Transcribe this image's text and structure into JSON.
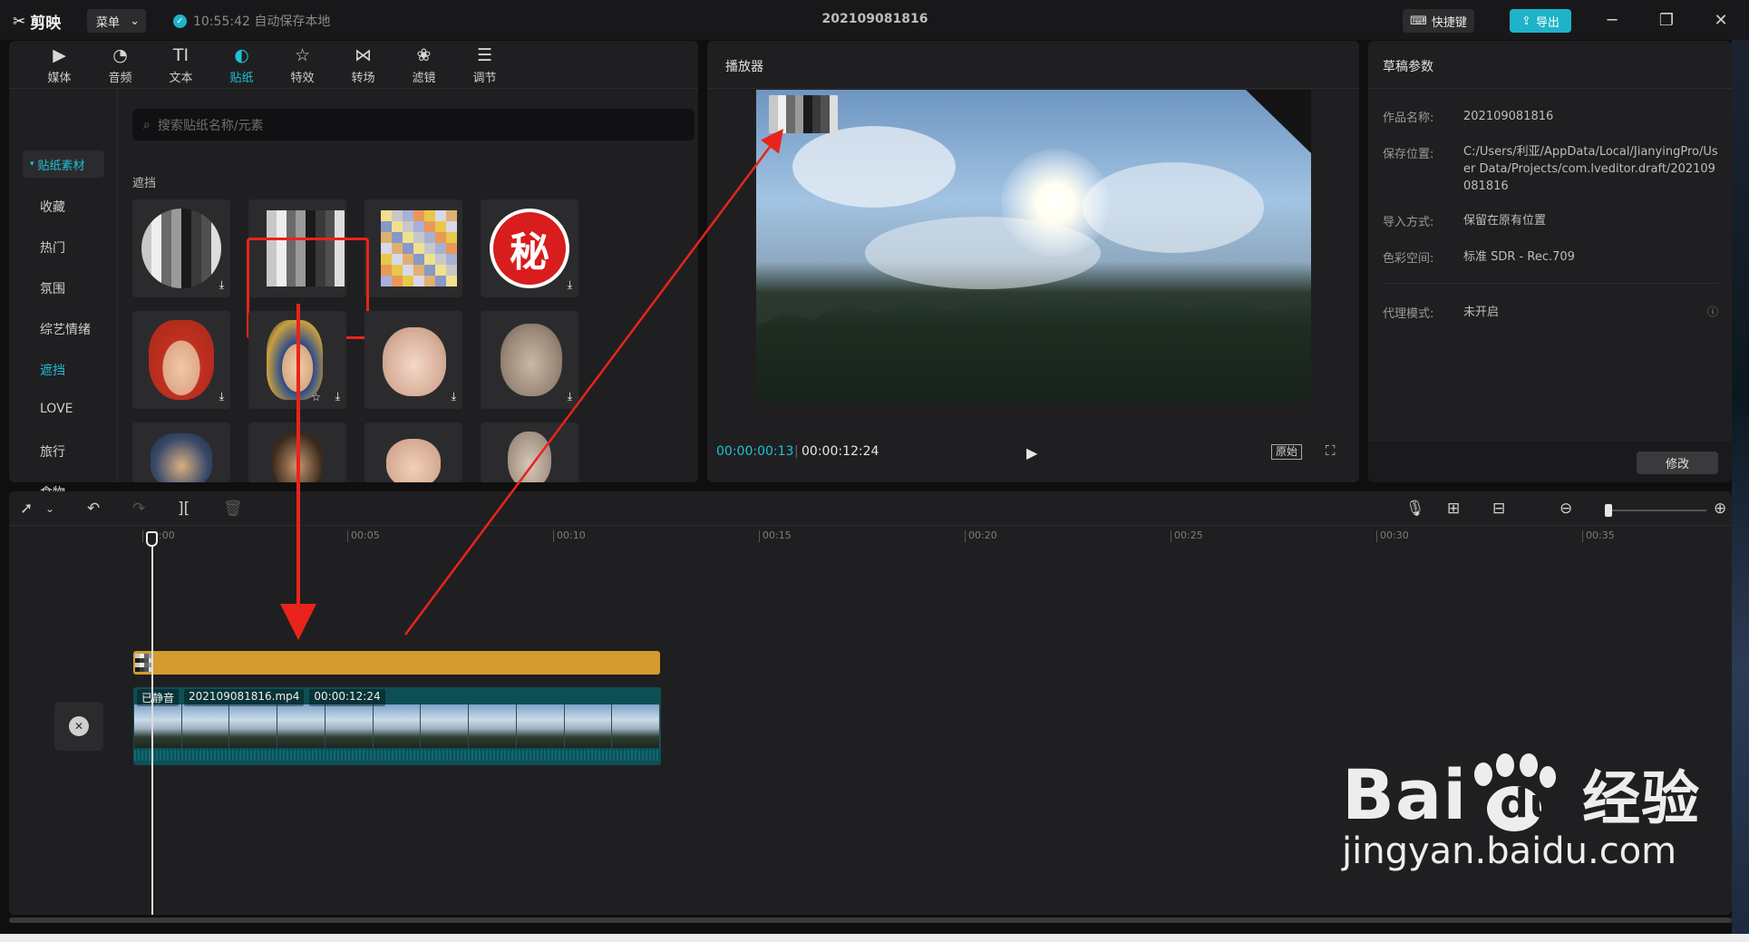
{
  "app": {
    "name": "剪映",
    "menu_label": "菜单",
    "autosave_text": "10:55:42 自动保存本地",
    "project_title": "202109081816",
    "shortcut_label": "快捷键",
    "export_label": "导出"
  },
  "toolbar_tabs": [
    {
      "label": "媒体",
      "icon": "media-icon"
    },
    {
      "label": "音频",
      "icon": "audio-icon"
    },
    {
      "label": "文本",
      "icon": "text-icon"
    },
    {
      "label": "贴纸",
      "icon": "sticker-icon"
    },
    {
      "label": "特效",
      "icon": "effects-icon"
    },
    {
      "label": "转场",
      "icon": "transition-icon"
    },
    {
      "label": "滤镜",
      "icon": "filter-icon"
    },
    {
      "label": "调节",
      "icon": "adjust-icon"
    }
  ],
  "sticker_panel": {
    "category_header": "贴纸素材",
    "categories": [
      "收藏",
      "热门",
      "氛围",
      "综艺情绪",
      "遮挡",
      "LOVE",
      "旅行",
      "食物"
    ],
    "active_category": "遮挡",
    "search_placeholder": "搜索贴纸名称/元素",
    "section_label": "遮挡",
    "special_sticker_text": "秘"
  },
  "player": {
    "title": "播放器",
    "current_time": "00:00:00:13",
    "total_time": "00:00:12:24",
    "original_label": "原始"
  },
  "draft": {
    "title": "草稿参数",
    "fields": [
      {
        "key": "作品名称:",
        "value": "202109081816"
      },
      {
        "key": "保存位置:",
        "value": "C:/Users/利亚/AppData/Local/JianyingPro/User Data/Projects/com.lveditor.draft/202109081816"
      },
      {
        "key": "导入方式:",
        "value": "保留在原有位置"
      },
      {
        "key": "色彩空间:",
        "value": "标准 SDR - Rec.709"
      },
      {
        "key": "代理模式:",
        "value": "未开启"
      }
    ],
    "modify_label": "修改"
  },
  "timeline": {
    "ticks": [
      "00:00",
      "00:05",
      "00:10",
      "00:15",
      "00:20",
      "00:25",
      "00:30",
      "00:35"
    ],
    "video_clip": {
      "muted_label": "已静音",
      "filename": "202109081816.mp4",
      "duration": "00:00:12:24"
    }
  },
  "watermark": {
    "brand": "Bai",
    "brand_suffix": "du",
    "cn": "经验",
    "url": "jingyan.baidu.com"
  },
  "colors": {
    "accent": "#1fc0d6",
    "sticker_track": "#d49b2e",
    "video_track": "#0e4f55",
    "annotation_red": "#e8241c"
  }
}
